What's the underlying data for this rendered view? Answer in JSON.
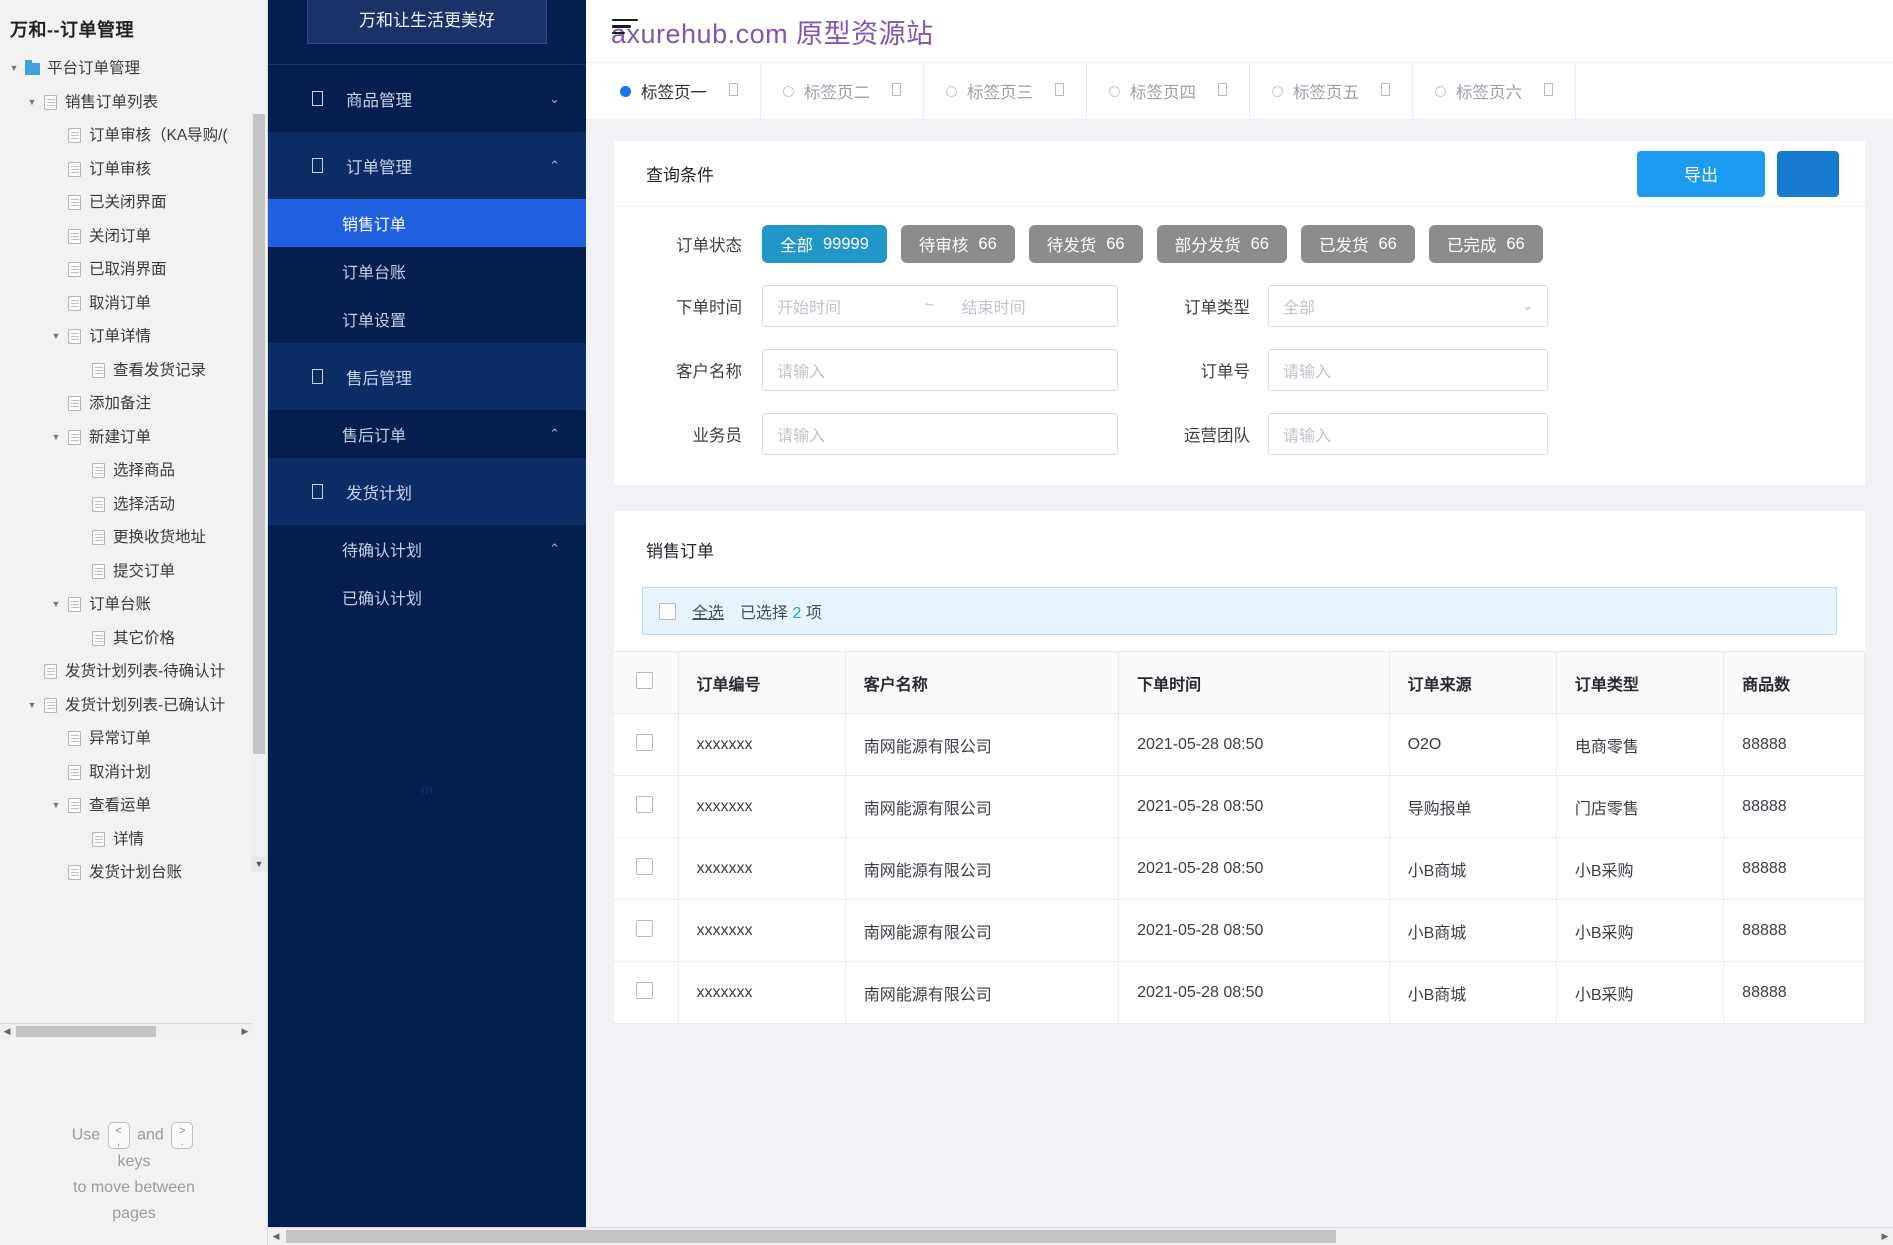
{
  "tree": {
    "title": "万和--订单管理",
    "nodes": [
      {
        "label": "平台订单管理",
        "level": 0,
        "icon": "folder-icon",
        "caret": "down"
      },
      {
        "label": "销售订单列表",
        "level": 1,
        "icon": "page-icon",
        "caret": "down"
      },
      {
        "label": "订单审核（KA导购/(",
        "level": 2,
        "icon": "page-icon",
        "caret": "none"
      },
      {
        "label": "订单审核",
        "level": 2,
        "icon": "page-icon",
        "caret": "none"
      },
      {
        "label": "已关闭界面",
        "level": 2,
        "icon": "page-icon",
        "caret": "none"
      },
      {
        "label": "关闭订单",
        "level": 2,
        "icon": "page-icon",
        "caret": "none"
      },
      {
        "label": "已取消界面",
        "level": 2,
        "icon": "page-icon",
        "caret": "none"
      },
      {
        "label": "取消订单",
        "level": 2,
        "icon": "page-icon",
        "caret": "none"
      },
      {
        "label": "订单详情",
        "level": 2,
        "icon": "page-icon",
        "caret": "down"
      },
      {
        "label": "查看发货记录",
        "level": 3,
        "icon": "page-icon",
        "caret": "none"
      },
      {
        "label": "添加备注",
        "level": 2,
        "icon": "page-icon",
        "caret": "none"
      },
      {
        "label": "新建订单",
        "level": 2,
        "icon": "page-icon",
        "caret": "down"
      },
      {
        "label": "选择商品",
        "level": 3,
        "icon": "page-icon",
        "caret": "none"
      },
      {
        "label": "选择活动",
        "level": 3,
        "icon": "page-icon",
        "caret": "none"
      },
      {
        "label": "更换收货地址",
        "level": 3,
        "icon": "page-icon",
        "caret": "none"
      },
      {
        "label": "提交订单",
        "level": 3,
        "icon": "page-icon",
        "caret": "none"
      },
      {
        "label": "订单台账",
        "level": 2,
        "icon": "page-icon",
        "caret": "down"
      },
      {
        "label": "其它价格",
        "level": 3,
        "icon": "page-icon",
        "caret": "none"
      },
      {
        "label": "发货计划列表-待确认计",
        "level": 1,
        "icon": "page-icon",
        "caret": "none"
      },
      {
        "label": "发货计划列表-已确认计",
        "level": 1,
        "icon": "page-icon",
        "caret": "down"
      },
      {
        "label": "异常订单",
        "level": 2,
        "icon": "page-icon",
        "caret": "none"
      },
      {
        "label": "取消计划",
        "level": 2,
        "icon": "page-icon",
        "caret": "none"
      },
      {
        "label": "查看运单",
        "level": 2,
        "icon": "page-icon",
        "caret": "down"
      },
      {
        "label": "详情",
        "level": 3,
        "icon": "page-icon",
        "caret": "none"
      },
      {
        "label": "发货计划台账",
        "level": 2,
        "icon": "page-icon",
        "caret": "none"
      }
    ],
    "hint": {
      "use": "Use",
      "and": "and",
      "key_prev": {
        "top": "<",
        "bottom": ","
      },
      "key_next": {
        "top": ">",
        "bottom": "."
      },
      "keys_word": "keys",
      "line2": "to move between",
      "line3": "pages"
    }
  },
  "nav": {
    "brand": "万和让生活更美好",
    "watermark": "m",
    "items": [
      {
        "label": "商品管理",
        "icon": "box-icon",
        "chevron": "⌄",
        "type": "group"
      },
      {
        "label": "订单管理",
        "icon": "box-icon",
        "chevron": "⌃",
        "type": "group",
        "highlight": true
      },
      {
        "label": "销售订单",
        "type": "sub",
        "active": true
      },
      {
        "label": "订单台账",
        "type": "sub"
      },
      {
        "label": "订单设置",
        "type": "sub"
      },
      {
        "label": "售后管理",
        "icon": "box-icon",
        "type": "group",
        "highlight": true
      },
      {
        "label": "售后订单",
        "type": "sub",
        "chevron": "⌃"
      },
      {
        "label": "发货计划",
        "icon": "box-icon",
        "type": "group",
        "highlight": true
      },
      {
        "label": "待确认计划",
        "type": "sub",
        "chevron": "⌃"
      },
      {
        "label": "已确认计划",
        "type": "sub"
      }
    ]
  },
  "header": {
    "logo_text": "axurehub.com 原型资源站",
    "tabs": [
      {
        "label": "标签页一",
        "active": true,
        "close": "close-icon"
      },
      {
        "label": "标签页二",
        "active": false,
        "close": "close-icon"
      },
      {
        "label": "标签页三",
        "active": false,
        "close": "close-icon"
      },
      {
        "label": "标签页四",
        "active": false,
        "close": "close-icon"
      },
      {
        "label": "标签页五",
        "active": false,
        "close": "close-icon"
      },
      {
        "label": "标签页六",
        "active": false,
        "close": "close-icon"
      }
    ]
  },
  "filter": {
    "title": "查询条件",
    "export_label": "导出",
    "extra_label": "",
    "status_label": "订单状态",
    "status_options": [
      {
        "label": "全部",
        "count": "99999",
        "active": true
      },
      {
        "label": "待审核",
        "count": "66",
        "active": false
      },
      {
        "label": "待发货",
        "count": "66",
        "active": false
      },
      {
        "label": "部分发货",
        "count": "66",
        "active": false
      },
      {
        "label": "已发货",
        "count": "66",
        "active": false
      },
      {
        "label": "已完成",
        "count": "66",
        "active": false
      }
    ],
    "order_time_label": "下单时间",
    "date_start_placeholder": "开始时间",
    "date_tilde": "~",
    "date_end_placeholder": "结束时间",
    "order_type_label": "订单类型",
    "order_type_value": "全部",
    "customer_label": "客户名称",
    "customer_placeholder": "请输入",
    "order_no_label": "订单号",
    "order_no_placeholder": "请输入",
    "salesman_label": "业务员",
    "salesman_placeholder": "请输入",
    "team_label": "运营团队",
    "team_placeholder": "请输入"
  },
  "table": {
    "title": "销售订单",
    "select_all_label": "全选",
    "selected_prefix": "已选择",
    "selected_count": "2",
    "selected_suffix": "项",
    "columns": [
      "",
      "订单编号",
      "客户名称",
      "下单时间",
      "订单来源",
      "订单类型",
      "商品数"
    ],
    "rows": [
      [
        "",
        "xxxxxxx",
        "南网能源有限公司",
        "2021-05-28 08:50",
        "O2O",
        "电商零售",
        "88888"
      ],
      [
        "",
        "xxxxxxx",
        "南网能源有限公司",
        "2021-05-28 08:50",
        "导购报单",
        "门店零售",
        "88888"
      ],
      [
        "",
        "xxxxxxx",
        "南网能源有限公司",
        "2021-05-28 08:50",
        "小B商城",
        "小B采购",
        "88888"
      ],
      [
        "",
        "xxxxxxx",
        "南网能源有限公司",
        "2021-05-28 08:50",
        "小B商城",
        "小B采购",
        "88888"
      ],
      [
        "",
        "xxxxxxx",
        "南网能源有限公司",
        "2021-05-28 08:50",
        "小B商城",
        "小B采购",
        "88888"
      ]
    ]
  },
  "colors": {
    "nav_bg": "#041f4e",
    "nav_active": "#1f5fe0",
    "accent": "#1d9bf0",
    "pill_active": "#2196c9",
    "pill_idle": "#8c8c8c",
    "logo": "#7f57b5"
  }
}
